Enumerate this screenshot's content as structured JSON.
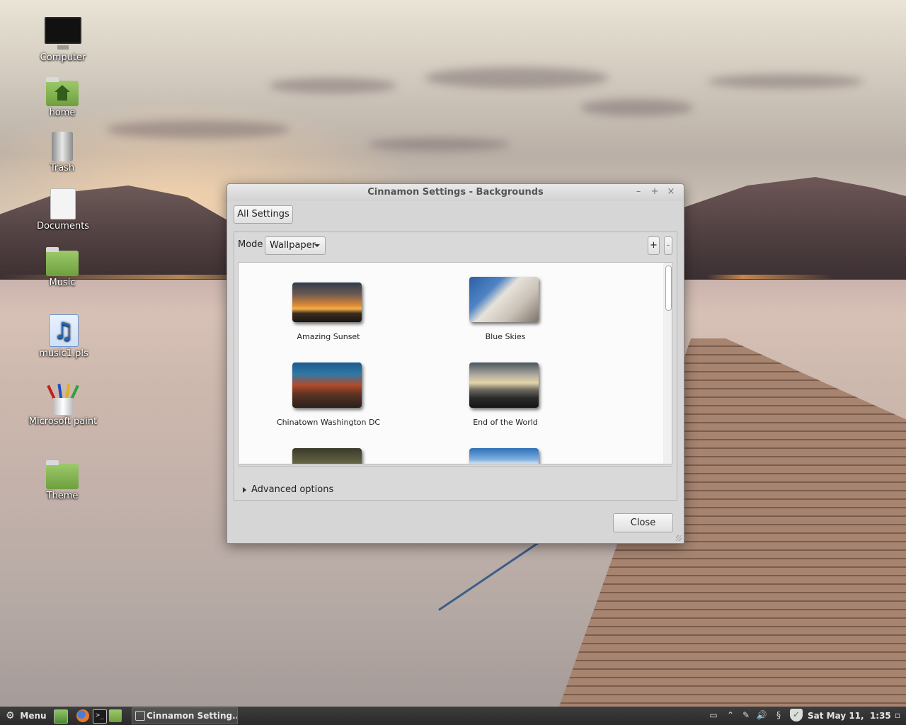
{
  "desktop": {
    "icons": [
      {
        "label": "Computer",
        "icon": "computer-icon"
      },
      {
        "label": "home",
        "icon": "home-folder-icon"
      },
      {
        "label": "Trash",
        "icon": "trash-icon"
      },
      {
        "label": "Documents",
        "icon": "document-icon"
      },
      {
        "label": "Music",
        "icon": "music-folder-icon"
      },
      {
        "label": "music1.pls",
        "icon": "music-file-icon"
      },
      {
        "label": "Microsoft paint",
        "icon": "paint-icon"
      },
      {
        "label": "Theme",
        "icon": "theme-folder-icon"
      }
    ]
  },
  "window": {
    "title": "Cinnamon Settings - Backgrounds",
    "controls": {
      "minimize": "–",
      "maximize": "+",
      "close": "×"
    },
    "all_settings_label": "All Settings",
    "mode_label": "Mode",
    "mode_value": "Wallpaper",
    "add_label": "+",
    "remove_label": "-",
    "wallpapers": [
      {
        "name": "Amazing Sunset"
      },
      {
        "name": "Blue Skies"
      },
      {
        "name": "Chinatown Washington DC"
      },
      {
        "name": "End of the World"
      }
    ],
    "advanced_label": "Advanced options",
    "close_label": "Close"
  },
  "taskbar": {
    "menu_label": "Menu",
    "task_label": "Cinnamon Setting...",
    "clock": "Sat May 11,  1:35"
  }
}
